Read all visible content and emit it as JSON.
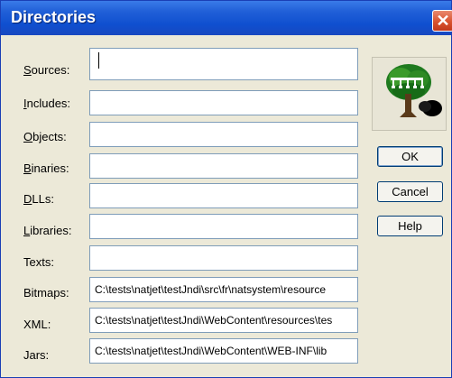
{
  "window": {
    "title": "Directories"
  },
  "fields": [
    {
      "label": "Sources:",
      "accel": "S",
      "rest": "ources:",
      "value": ""
    },
    {
      "label": "Includes:",
      "accel": "I",
      "rest": "ncludes:",
      "value": ""
    },
    {
      "label": "Objects:",
      "accel": "O",
      "rest": "bjects:",
      "value": ""
    },
    {
      "label": "Binaries:",
      "accel": "B",
      "rest": "inaries:",
      "value": ""
    },
    {
      "label": "DLLs:",
      "accel": "D",
      "rest": "LLs:",
      "value": ""
    },
    {
      "label": "Libraries:",
      "accel": "L",
      "rest": "ibraries:",
      "value": ""
    },
    {
      "label": "Texts:",
      "accel": "",
      "rest": "Texts:",
      "value": ""
    },
    {
      "label": "Bitmaps:",
      "accel": "",
      "rest": "Bitmaps:",
      "value": "C:\\tests\\natjet\\testJndi\\src\\fr\\natsystem\\resource"
    },
    {
      "label": "XML:",
      "accel": "",
      "rest": "XML:",
      "value": "C:\\tests\\natjet\\testJndi\\WebContent\\resources\\tes"
    },
    {
      "label": "Jars:",
      "accel": "",
      "rest": "Jars:",
      "value": "C:\\tests\\natjet\\testJndi\\WebContent\\WEB-INF\\lib"
    }
  ],
  "buttons": {
    "ok": "OK",
    "cancel": "Cancel",
    "help": "Help"
  },
  "icons": {
    "close": "close-icon",
    "tree": "directory-tree-icon"
  },
  "colors": {
    "titlebar": "#0f4fcf",
    "close": "#d9532f",
    "dialog_bg": "#ece9d8",
    "field_border": "#7f9db9"
  }
}
